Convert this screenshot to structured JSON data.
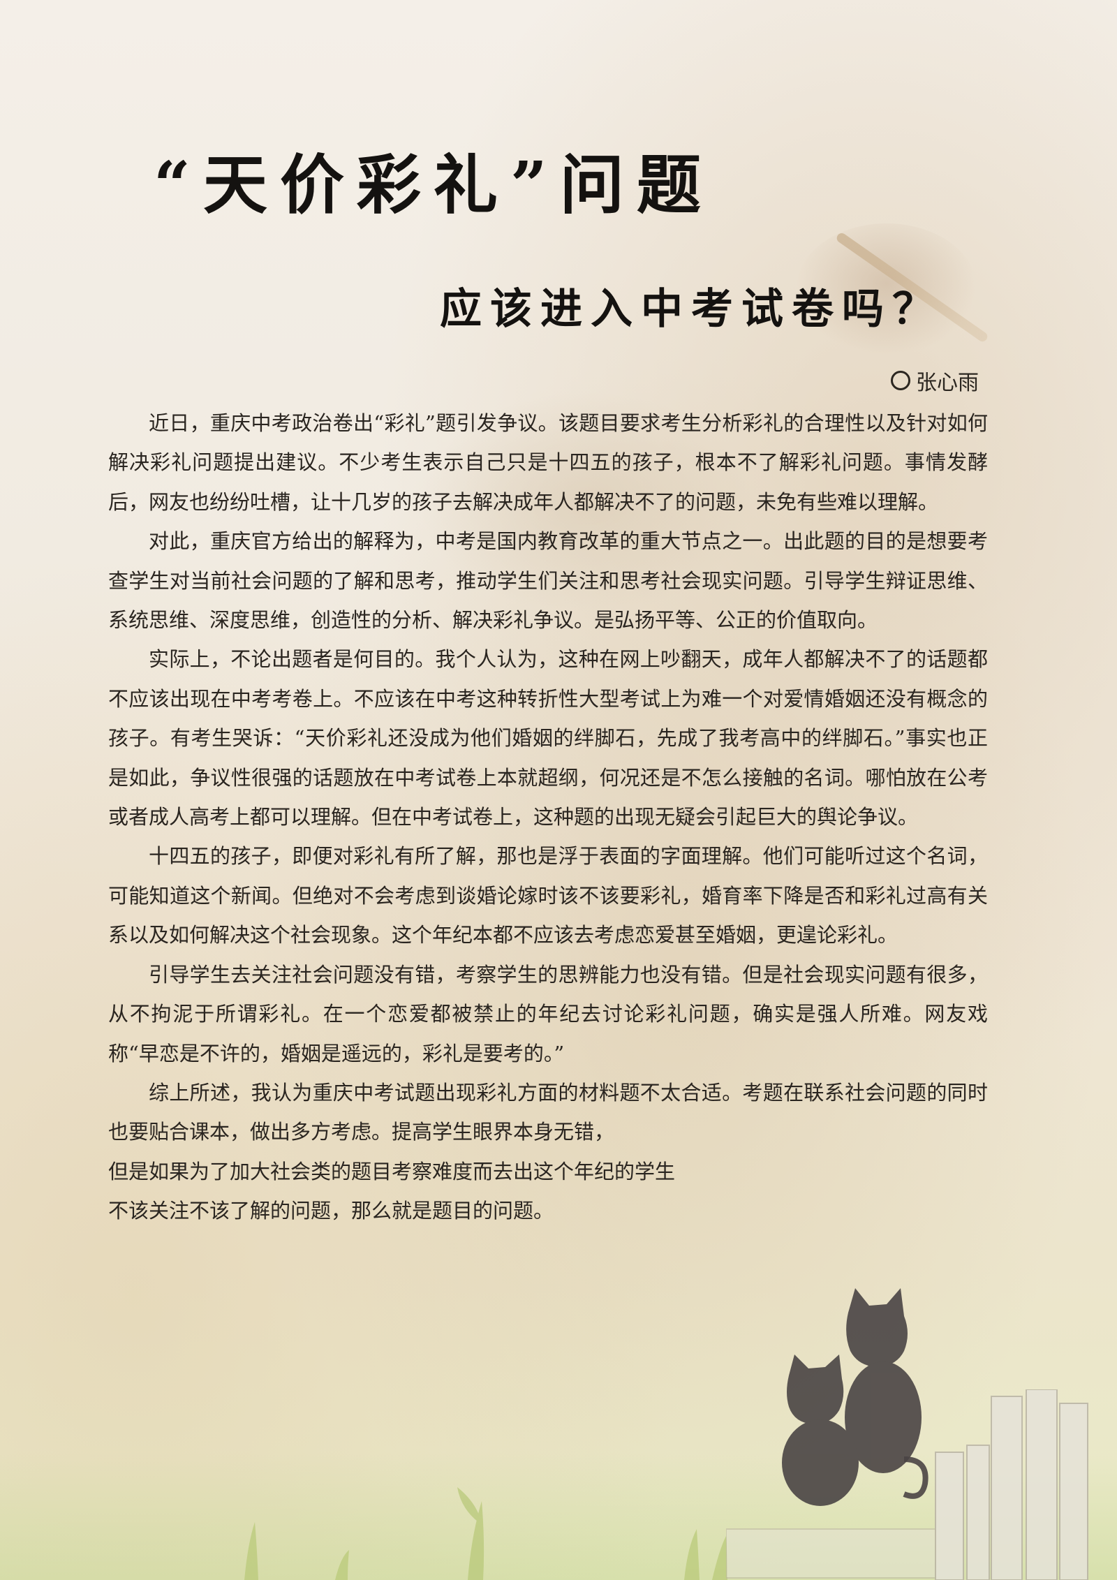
{
  "article": {
    "title": "“天价彩礼”问题",
    "subtitle": "应该进入中考试卷吗？",
    "author": "张心雨",
    "paragraphs": [
      "近日，重庆中考政治卷出“彩礼”题引发争议。该题目要求考生分析彩礼的合理性以及针对如何解决彩礼问题提出建议。不少考生表示自己只是十四五的孩子，根本不了解彩礼问题。事情发酵后，网友也纷纷吐槽，让十几岁的孩子去解决成年人都解决不了的问题，未免有些难以理解。",
      "对此，重庆官方给出的解释为，中考是国内教育改革的重大节点之一。出此题的目的是想要考查学生对当前社会问题的了解和思考，推动学生们关注和思考社会现实问题。引导学生辩证思维、系统思维、深度思维，创造性的分析、解决彩礼争议。是弘扬平等、公正的价值取向。",
      "实际上，不论出题者是何目的。我个人认为，这种在网上吵翻天，成年人都解决不了的话题都不应该出现在中考考卷上。不应该在中考这种转折性大型考试上为难一个对爱情婚姻还没有概念的孩子。有考生哭诉：“天价彩礼还没成为他们婚姻的绊脚石，先成了我考高中的绊脚石。”事实也正是如此，争议性很强的话题放在中考试卷上本就超纲，何况还是不怎么接触的名词。哪怕放在公考或者成人高考上都可以理解。但在中考试卷上，这种题的出现无疑会引起巨大的舆论争议。",
      "十四五的孩子，即便对彩礼有所了解，那也是浮于表面的字面理解。他们可能听过这个名词，可能知道这个新闻。但绝对不会考虑到谈婚论嫁时该不该要彩礼，婚育率下降是否和彩礼过高有关系以及如何解决这个社会现象。这个年纪本都不应该去考虑恋爱甚至婚姻，更遑论彩礼。",
      "引导学生去关注社会问题没有错，考察学生的思辨能力也没有错。但是社会现实问题有很多，从不拘泥于所谓彩礼。在一个恋爱都被禁止的年纪去讨论彩礼问题，确实是强人所难。网友戏称“早恋是不许的，婚姻是遥远的，彩礼是要考的。”",
      "综上所述，我认为重庆中考试题出现彩礼方面的材料题不太合适。考题在联系社会问题的同时也要贴合课本，做出多方考虑。提高学生眼界本身无错，"
    ],
    "closing_lines": [
      "但是如果为了加大社会类的题目考察难度而去出这个年纪的学生",
      "不该关注不该了解的问题，那么就是题目的问题。"
    ]
  },
  "colors": {
    "title": "#141210",
    "text": "#2a2520",
    "background": "#f1ebe1"
  },
  "icons": {
    "byline_marker": "circle-icon"
  }
}
